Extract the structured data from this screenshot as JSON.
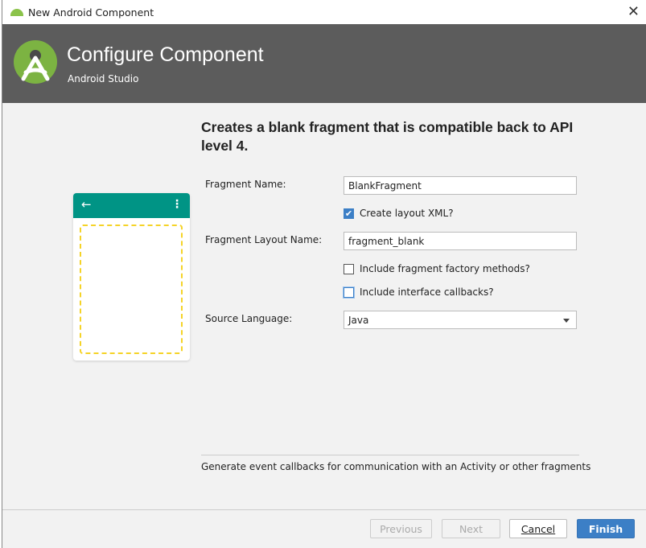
{
  "window": {
    "title": "New Android Component",
    "close_icon": "close-icon"
  },
  "header": {
    "title": "Configure Component",
    "subtitle": "Android Studio",
    "logo": "android-studio-logo"
  },
  "preview": {
    "back_icon": "←",
    "menu_icon": "⋮",
    "toolbar_color": "#009485",
    "placeholder_color": "#f5d327"
  },
  "description": "Creates a blank fragment that is compatible back to API level 4.",
  "form": {
    "fragment_name_label": "Fragment Name:",
    "fragment_name_value": "BlankFragment",
    "create_layout_label": "Create layout XML?",
    "create_layout_checked": true,
    "layout_name_label": "Fragment Layout Name:",
    "layout_name_value": "fragment_blank",
    "factory_label": "Include fragment factory methods?",
    "factory_checked": false,
    "callbacks_label": "Include interface callbacks?",
    "callbacks_checked": false,
    "language_label": "Source Language:",
    "language_value": "Java",
    "check_mark": "✔"
  },
  "hint": "Generate event callbacks for communication with an Activity or other fragments",
  "buttons": {
    "previous": "Previous",
    "next": "Next",
    "cancel": "Cancel",
    "finish": "Finish"
  },
  "accent": "#3c7fc6"
}
